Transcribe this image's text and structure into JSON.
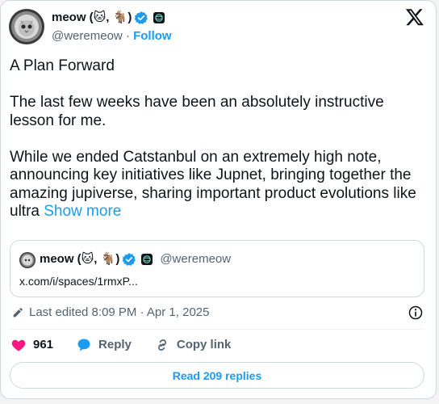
{
  "author": {
    "name": "meow (🐱, 🐐)",
    "handle": "@weremeow",
    "separator": "·",
    "follow_label": "Follow",
    "avatar_icon": "astronaut-cat-avatar",
    "verified_icon": "verified-badge-icon",
    "org_icon": "jupiter-org-badge-icon"
  },
  "platform_icon": "x-logo-icon",
  "post": {
    "paragraphs": [
      "A Plan Forward",
      "The last few weeks have been an absolutely instructive lesson for me.",
      "While we ended Catstanbul on an extremely high note, announcing key initiatives like Jupnet, bringing together the amazing jupiverse, sharing important product evolutions like ultra"
    ],
    "show_more": "Show more"
  },
  "quote": {
    "name": "meow (🐱, 🐐)",
    "handle": "@weremeow",
    "link": "x.com/i/spaces/1rmxP..."
  },
  "meta": {
    "edited_text": "Last edited 8:09 PM · Apr 1, 2025"
  },
  "actions": {
    "likes": "961",
    "reply": "Reply",
    "copy_link": "Copy link"
  },
  "read_replies": "Read 209 replies",
  "colors": {
    "accent": "#1d9bf0",
    "like": "#f91880",
    "text": "#0f1419",
    "muted": "#536471",
    "border": "#cfd9de"
  }
}
